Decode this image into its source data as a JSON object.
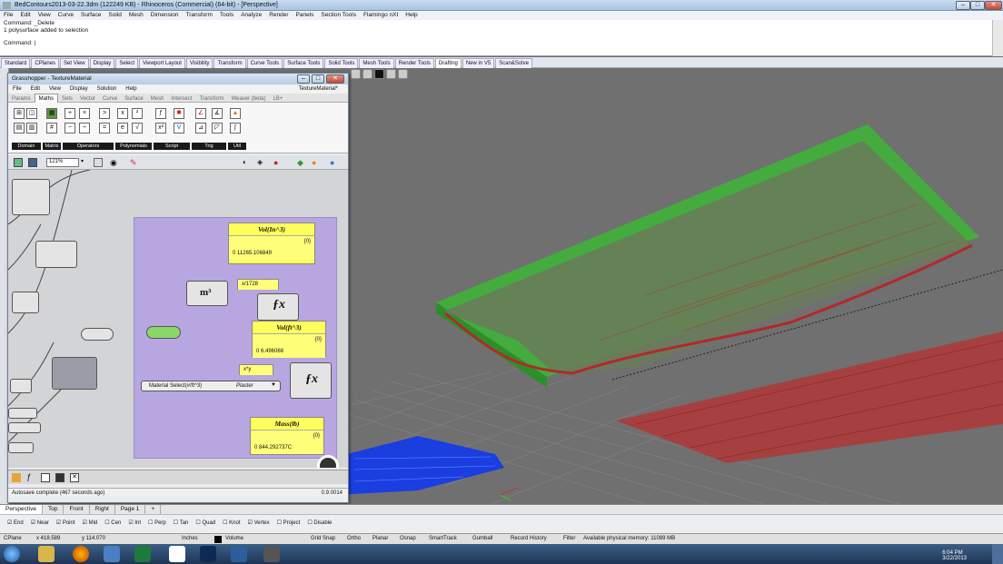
{
  "window": {
    "title": "BedContours2013-03-22.3dm (122249 KB) - Rhinoceros (Commercial) (64-bit) - [Perspective]"
  },
  "menu": [
    "File",
    "Edit",
    "View",
    "Curve",
    "Surface",
    "Solid",
    "Mesh",
    "Dimension",
    "Transform",
    "Tools",
    "Analyze",
    "Render",
    "Panels",
    "Section Tools",
    "Flamingo nXt",
    "Help"
  ],
  "command": {
    "line1": "Command: _Delete",
    "line2": "1 polysurface added to selection",
    "prompt": "Command:"
  },
  "toolbar_tabs": [
    "Standard",
    "CPlanes",
    "Set View",
    "Display",
    "Select",
    "Viewport Layout",
    "Visibility",
    "Transform",
    "Curve Tools",
    "Surface Tools",
    "Solid Tools",
    "Mesh Tools",
    "Render Tools",
    "Drafting",
    "New in V5",
    "Scan&Solve"
  ],
  "toolbar_active": "Drafting",
  "grasshopper": {
    "title": "Grasshopper - TextureMaterial",
    "doc": "TextureMaterial*",
    "menu": [
      "File",
      "Edit",
      "View",
      "Display",
      "Solution",
      "Help"
    ],
    "tabs": [
      "Params",
      "Maths",
      "Sets",
      "Vector",
      "Curve",
      "Surface",
      "Mesh",
      "Intersect",
      "Transform",
      "Weaver (beta)",
      "LB+"
    ],
    "active_tab": "Maths",
    "groups": [
      "Domain",
      "Matrix",
      "Operators",
      "Polynomials",
      "Script",
      "Trig",
      "Util"
    ],
    "zoom": "121%",
    "panels": {
      "vol_in3": {
        "header": "Vol(In^3)",
        "path": "{0}",
        "value": "0  11265.106849"
      },
      "vol_ft3": {
        "header": "Vol(ft^3)",
        "path": "{0}",
        "value": "0  6.496068"
      },
      "mass": {
        "header": "Mass(lb)",
        "path": "{0}",
        "value": "0  844.292737C"
      }
    },
    "relay_small": "x/1728",
    "relay_small2": "x*y",
    "material_select": "Material Select(#/ft^3)",
    "material_value": "Plaster",
    "status": "Autosave complete (467 seconds ago)",
    "version": "0.9.0014"
  },
  "viewport_tabs": [
    "Perspective",
    "Top",
    "Front",
    "Right",
    "Page 1"
  ],
  "active_view": "Perspective",
  "osnaps": [
    "End",
    "Near",
    "Point",
    "Mid",
    "Cen",
    "Int",
    "Perp",
    "Tan",
    "Quad",
    "Knot",
    "Vertex",
    "Project",
    "Disable"
  ],
  "status": {
    "cplane": "CPlane",
    "x": "x 418.589",
    "y": "y 114.070",
    "units": "Inches",
    "layer": "Volume",
    "grid_snap": "Grid Snap",
    "ortho": "Ortho",
    "planar": "Planar",
    "osnap": "Osnap",
    "smarttrack": "SmartTrack",
    "gumball": "Gumball",
    "history": "Record History",
    "filter": "Filter",
    "message": "Available physical memory: 11089 MB"
  },
  "clock": {
    "time": "6:04 PM",
    "date": "3/22/2013"
  },
  "colors": {
    "green_slab": "#3fb33a",
    "red_mesh": "#c0282c",
    "blue_obj": "#1a3ee0",
    "gh_group": "#b8a6e0",
    "panel": "#ffff5c"
  }
}
